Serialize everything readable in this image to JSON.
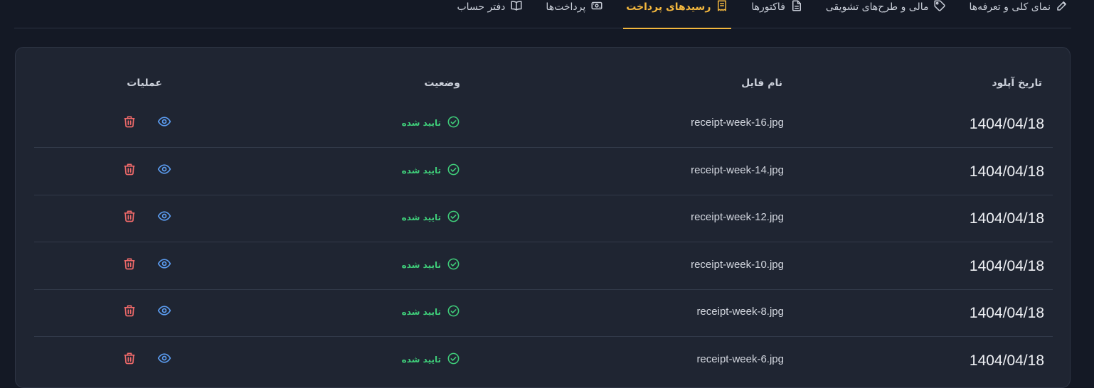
{
  "tabs": [
    {
      "label": "نمای کلی و تعرفه‌ها",
      "icon": "pencil-icon",
      "active": false
    },
    {
      "label": "مالی و طرح‌های تشویقی",
      "icon": "tag-icon",
      "active": false
    },
    {
      "label": "فاکتورها",
      "icon": "document-icon",
      "active": false
    },
    {
      "label": "رسیدهای پرداخت",
      "icon": "receipt-icon",
      "active": true
    },
    {
      "label": "پرداخت‌ها",
      "icon": "cash-icon",
      "active": false
    },
    {
      "label": "دفتر حساب",
      "icon": "book-icon",
      "active": false
    }
  ],
  "table": {
    "headers": {
      "date": "تاریخ آپلود",
      "file": "نام فایل",
      "status": "وضعیت",
      "actions": "عملیات"
    },
    "rows": [
      {
        "date": "1404/04/18",
        "file": "receipt-week-16.jpg",
        "status": "تایید شده"
      },
      {
        "date": "1404/04/18",
        "file": "receipt-week-14.jpg",
        "status": "تایید شده"
      },
      {
        "date": "1404/04/18",
        "file": "receipt-week-12.jpg",
        "status": "تایید شده"
      },
      {
        "date": "1404/04/18",
        "file": "receipt-week-10.jpg",
        "status": "تایید شده"
      },
      {
        "date": "1404/04/18",
        "file": "receipt-week-8.jpg",
        "status": "تایید شده"
      },
      {
        "date": "1404/04/18",
        "file": "receipt-week-6.jpg",
        "status": "تایید شده"
      }
    ]
  },
  "colors": {
    "accent": "#f3b73e",
    "success": "#3fce7a",
    "view": "#5b9cf0",
    "danger": "#f06a6a"
  }
}
